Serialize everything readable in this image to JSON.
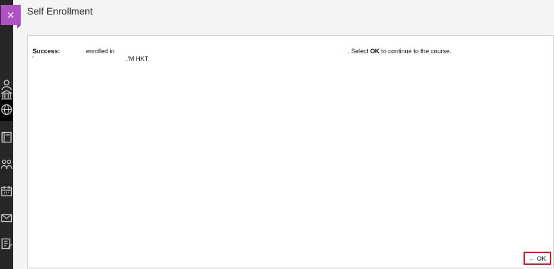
{
  "page": {
    "title": "Self Enrollment"
  },
  "sidebar": {
    "close_glyph": "×",
    "icons": [
      "institution-icon",
      "user-icon",
      "globe-icon",
      "book-icon",
      "people-icon",
      "calendar-icon",
      "mail-icon",
      "grades-icon"
    ]
  },
  "message": {
    "success_label": "Success:",
    "enrolled_text": "enrolled in",
    "select_text": ". Select",
    "ok_word": "OK",
    "continue_text": "to continue to the course.",
    "line2_start": "'",
    "line2_time": ".'M HKT"
  },
  "ok_button": {
    "arrow": "←",
    "label": "OK"
  },
  "colors": {
    "accent": "#b052c6",
    "sidebar": "#262626",
    "highlight": "#e0141e"
  }
}
